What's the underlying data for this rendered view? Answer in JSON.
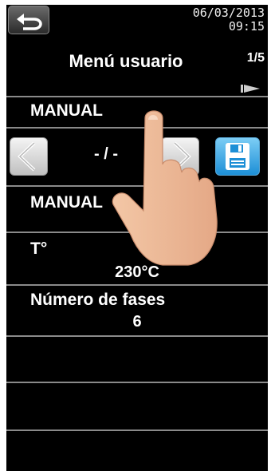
{
  "header": {
    "date": "06/03/2013",
    "time": "09:15",
    "title": "Menú usuario",
    "page": "1/5"
  },
  "rows": {
    "mode_top": "MANUAL",
    "date_value": "- / -",
    "mode": "MANUAL",
    "temp_label": "T°",
    "temp_value": "230°C",
    "phases_label": "Número de fases",
    "phases_value": "6"
  },
  "colors": {
    "background": "#000000",
    "divider": "#8a8a8a",
    "save_button": "#1d8fd6"
  },
  "icons": {
    "back": "back-arrow-icon",
    "next": "next-page-arrow-icon",
    "left": "chevron-left-icon",
    "right": "chevron-right-icon",
    "save": "floppy-disk-icon"
  }
}
